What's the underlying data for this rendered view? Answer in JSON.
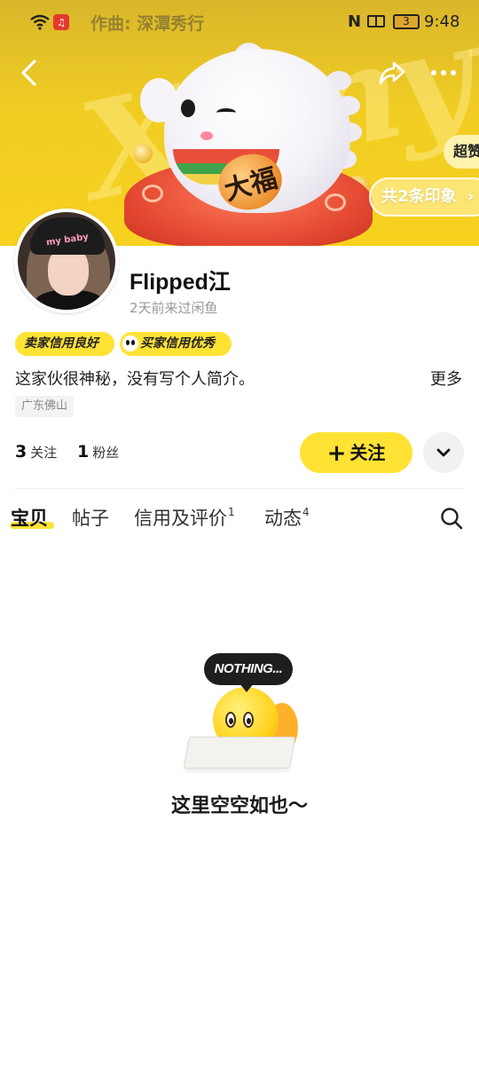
{
  "status_bar": {
    "song": "作曲: 深潭秀行",
    "battery": "3",
    "time": "9:48",
    "nfc": "N"
  },
  "banner": {
    "background_word": "Xianyu",
    "coin_text": "大福",
    "super_chip": "超赞",
    "impressions_chip": "共2条印象",
    "chevron": "›"
  },
  "avatar": {
    "hat_text": "my baby"
  },
  "profile": {
    "username": "Flipped江",
    "last_seen": "2天前来过闲鱼",
    "badges": {
      "seller": "卖家信用良好",
      "buyer": "买家信用优秀"
    },
    "bio": "这家伙很神秘，没有写个人简介。",
    "bio_more": "更多",
    "location": "广东佛山"
  },
  "stats": {
    "following_count": "3",
    "following_label": "关注",
    "followers_count": "1",
    "followers_label": "粉丝"
  },
  "actions": {
    "follow_plus": "+",
    "follow_label": "关注"
  },
  "tabs": [
    {
      "label": "宝贝",
      "sup": ""
    },
    {
      "label": "帖子",
      "sup": ""
    },
    {
      "label": "信用及评价",
      "sup": "1"
    },
    {
      "label": "动态",
      "sup": "4"
    }
  ],
  "empty_state": {
    "bubble": "NOTHING...",
    "text": "这里空空如也～"
  },
  "colors": {
    "accent": "#ffe234",
    "banner": "#f1cd24"
  }
}
